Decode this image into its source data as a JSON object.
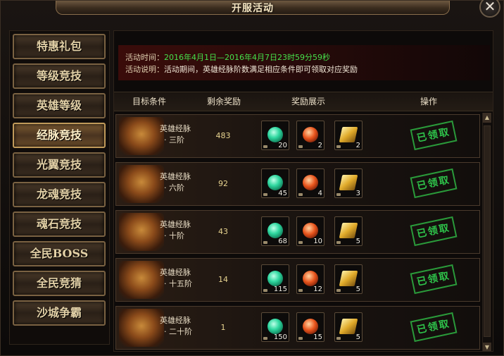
{
  "window": {
    "title": "开服活动",
    "close_label": "✕"
  },
  "sidebar": {
    "items": [
      {
        "label": "特惠礼包",
        "active": false
      },
      {
        "label": "等级竞技",
        "active": false
      },
      {
        "label": "英雄等级",
        "active": false
      },
      {
        "label": "经脉竞技",
        "active": true
      },
      {
        "label": "光翼竞技",
        "active": false
      },
      {
        "label": "龙魂竞技",
        "active": false
      },
      {
        "label": "魂石竞技",
        "active": false
      },
      {
        "label": "全民BOSS",
        "active": false
      },
      {
        "label": "全民竞猜",
        "active": false
      },
      {
        "label": "沙城争霸",
        "active": false
      }
    ]
  },
  "activity": {
    "time_label": "活动时间：",
    "time_value": "2016年4月1日—2016年4月7日23时59分59秒",
    "desc_label": "活动说明：",
    "desc_value": "活动期间，英雄经脉阶数满足相应条件即可领取对应奖励"
  },
  "table": {
    "headers": {
      "target": "目标条件",
      "remaining": "剩余奖励",
      "rewards": "奖励展示",
      "action": "操作"
    },
    "rows": [
      {
        "name": "英雄经脉",
        "tier": "· 三阶",
        "remaining": "483",
        "rewards": [
          "20",
          "2",
          "2"
        ],
        "status": "已领取"
      },
      {
        "name": "英雄经脉",
        "tier": "· 六阶",
        "remaining": "92",
        "rewards": [
          "45",
          "4",
          "3"
        ],
        "status": "已领取"
      },
      {
        "name": "英雄经脉",
        "tier": "· 十阶",
        "remaining": "43",
        "rewards": [
          "68",
          "10",
          "5"
        ],
        "status": "已领取"
      },
      {
        "name": "英雄经脉",
        "tier": "· 十五阶",
        "remaining": "14",
        "rewards": [
          "115",
          "12",
          "5"
        ],
        "status": "已领取"
      },
      {
        "name": "英雄经脉",
        "tier": "· 二十阶",
        "remaining": "1",
        "rewards": [
          "150",
          "15",
          "5"
        ],
        "status": "已领取"
      }
    ]
  },
  "icons": {
    "reward_1": "green-gem-icon",
    "reward_2": "red-orb-icon",
    "reward_3": "gold-bar-icon",
    "scroll_up": "▲",
    "scroll_down": "▼"
  }
}
